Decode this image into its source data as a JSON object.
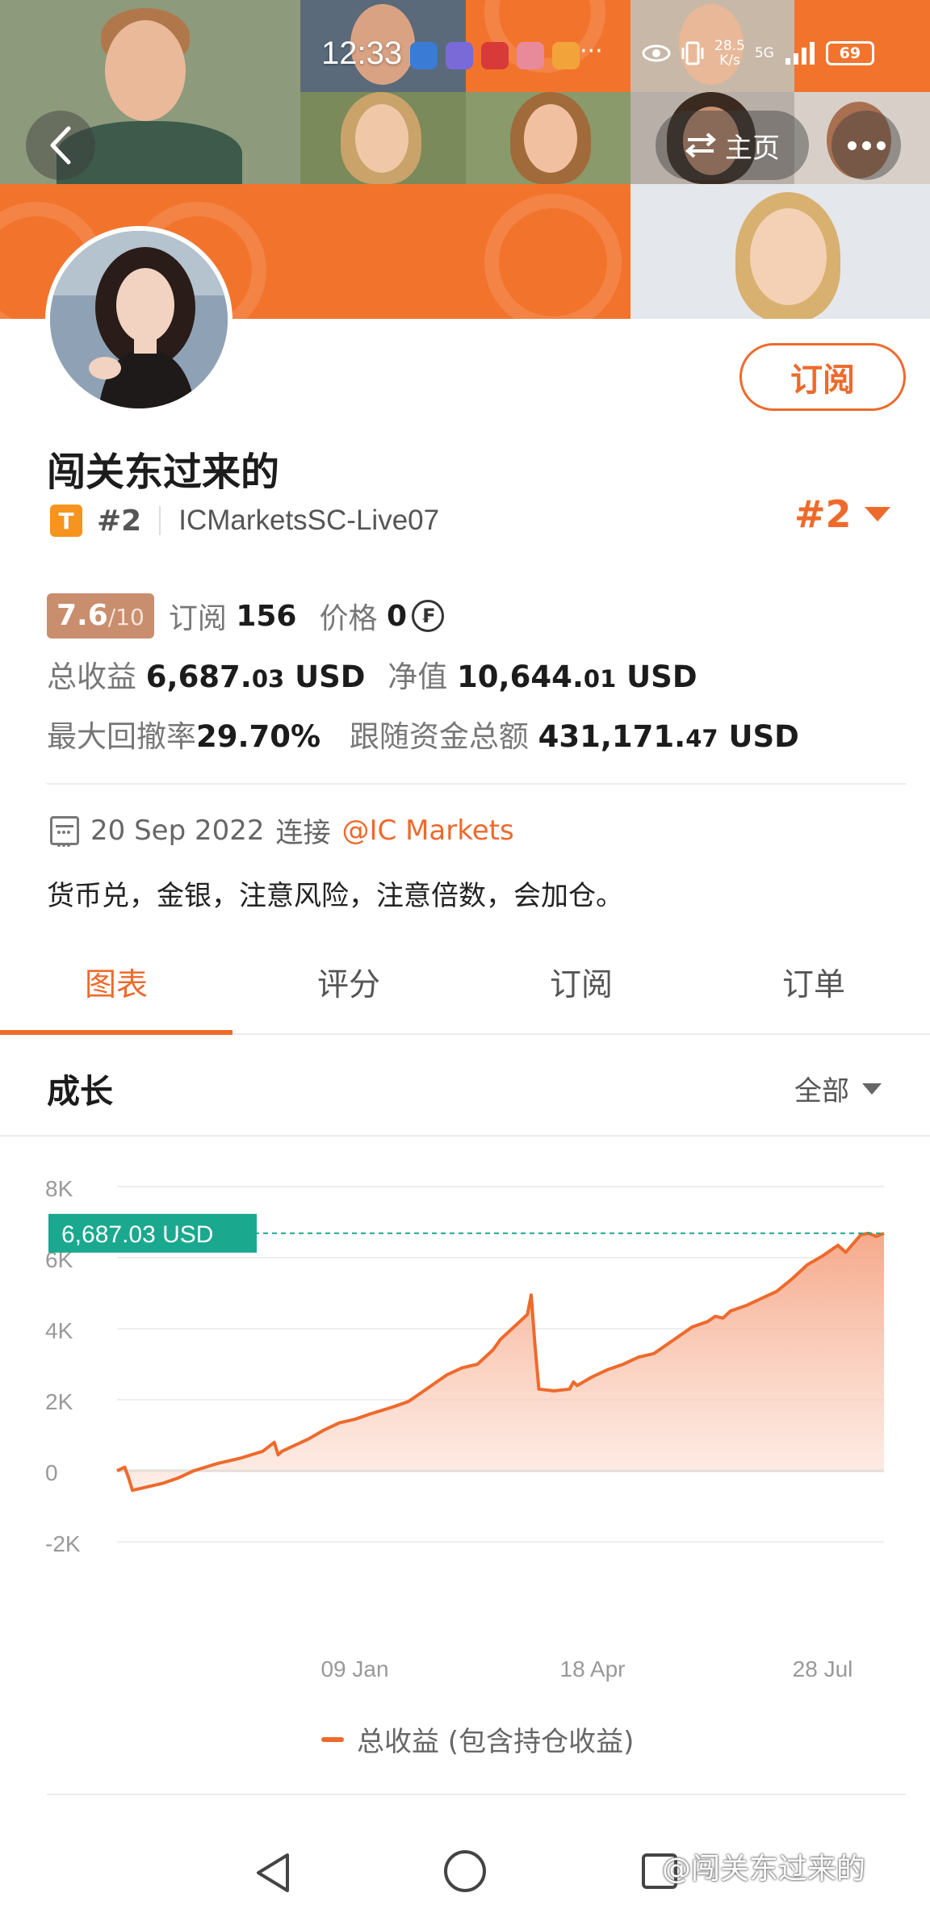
{
  "status_bar": {
    "time": "12:33",
    "net_speed_value": "28.5",
    "net_speed_unit": "K/s",
    "battery": "69",
    "signal": "5G"
  },
  "header": {
    "home_label": "主页",
    "subscribe_label": "订阅"
  },
  "profile": {
    "name": "闯关东过来的",
    "badge_letter": "T",
    "rank_small": "#2",
    "account": "ICMarketsSC-Live07",
    "rank_big": "#2"
  },
  "stats": {
    "score": "7.6",
    "score_max": "/10",
    "subscribe_label": "订阅",
    "subscribe_count": "156",
    "price_label": "价格",
    "price_value": "0",
    "total_profit_label": "总收益",
    "total_profit_int": "6,687.",
    "total_profit_dec": "03",
    "total_profit_unit": "USD",
    "equity_label": "净值",
    "equity_int": "10,644.",
    "equity_dec": "01",
    "equity_unit": "USD",
    "drawdown_label": "最大回撤率",
    "drawdown_value": "29.70%",
    "follow_label": "跟随资金总额",
    "follow_int": "431,171.",
    "follow_dec": "47",
    "follow_unit": "USD"
  },
  "connection": {
    "date": "20 Sep 2022",
    "connect_label": "连接",
    "broker": "@IC Markets"
  },
  "description": "货币兑，金银，注意风险，注意倍数，会加仓。",
  "tabs": [
    {
      "label": "图表",
      "active": true
    },
    {
      "label": "评分",
      "active": false
    },
    {
      "label": "订阅",
      "active": false
    },
    {
      "label": "订单",
      "active": false
    }
  ],
  "section": {
    "title": "成长",
    "range": "全部"
  },
  "chart_data": {
    "type": "area",
    "ylim": [
      -2000,
      8000
    ],
    "yticks": [
      "8K",
      "6K",
      "4K",
      "2K",
      "0",
      "-2K"
    ],
    "ytick_values": [
      8000,
      6000,
      4000,
      2000,
      0,
      -2000
    ],
    "xticks": [
      "09 Jan",
      "18 Apr",
      "28 Jul"
    ],
    "xtick_positions": [
      0.31,
      0.62,
      0.92
    ],
    "current_label": "6,687.03 USD",
    "current_value": 6687.03,
    "series": [
      {
        "name": "总收益 (包含持仓收益)",
        "x": [
          0,
          0.01,
          0.015,
          0.02,
          0.04,
          0.06,
          0.08,
          0.1,
          0.13,
          0.16,
          0.19,
          0.205,
          0.21,
          0.215,
          0.23,
          0.25,
          0.27,
          0.29,
          0.31,
          0.33,
          0.36,
          0.38,
          0.39,
          0.41,
          0.43,
          0.45,
          0.47,
          0.49,
          0.5,
          0.52,
          0.535,
          0.54,
          0.545,
          0.55,
          0.57,
          0.59,
          0.595,
          0.6,
          0.62,
          0.64,
          0.66,
          0.68,
          0.7,
          0.7,
          0.71,
          0.72,
          0.73,
          0.75,
          0.77,
          0.78,
          0.79,
          0.8,
          0.82,
          0.84,
          0.86,
          0.88,
          0.9,
          0.92,
          0.94,
          0.95,
          0.96,
          0.97,
          0.98,
          0.99,
          1.0
        ],
        "y": [
          0,
          100,
          -200,
          -550,
          -450,
          -350,
          -200,
          0,
          200,
          350,
          550,
          800,
          450,
          550,
          700,
          900,
          1150,
          1350,
          1450,
          1600,
          1800,
          1950,
          2100,
          2400,
          2700,
          2900,
          3000,
          3400,
          3700,
          4100,
          4400,
          4950,
          3500,
          2300,
          2250,
          2300,
          2500,
          2400,
          2650,
          2850,
          3000,
          3200,
          3300,
          3300,
          3450,
          3600,
          3750,
          4050,
          4200,
          4350,
          4300,
          4500,
          4650,
          4850,
          5050,
          5400,
          5800,
          6050,
          6350,
          6150,
          6400,
          6650,
          6687.03,
          6600,
          6687.03
        ]
      }
    ]
  },
  "legend_label": "总收益 (包含持仓收益)",
  "watermark": "@闯关东过来的",
  "colors": {
    "accent": "#ee6a2c",
    "teal": "#1aa88e",
    "score_bg": "#c98e6e",
    "banner": "#f2742c"
  }
}
